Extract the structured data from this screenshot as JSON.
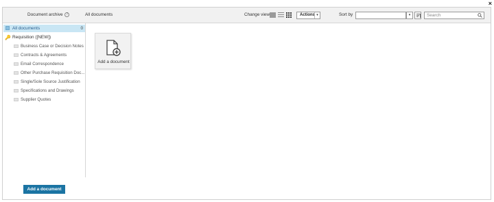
{
  "window": {
    "close_symbol": "×"
  },
  "header": {
    "archive_label": "Document archive",
    "help_symbol": "?",
    "breadcrumb": "All documents",
    "change_view_label": "Change view",
    "actions_label": "Actions",
    "caret_symbol": "▾",
    "sort_by_label": "Sort by",
    "sort_value": "",
    "search_placeholder": "Search"
  },
  "sidebar": {
    "all": {
      "label": "All documents",
      "count": "0"
    },
    "requisition": {
      "label": "Requisition ([NEW])"
    },
    "folders": [
      "Business Case or Decision Notes",
      "Contracts & Agreements",
      "Email Correspondence",
      "Other Purchase Requisition Doc...",
      "Single/Sole Source Justification",
      "Specifications and Drawings",
      "Supplier Quotes"
    ],
    "add_button": "Add a document"
  },
  "main": {
    "tile_label": "Add a document"
  },
  "colors": {
    "selected_bg": "#c9e6f4",
    "primary_button": "#1b74a3"
  }
}
